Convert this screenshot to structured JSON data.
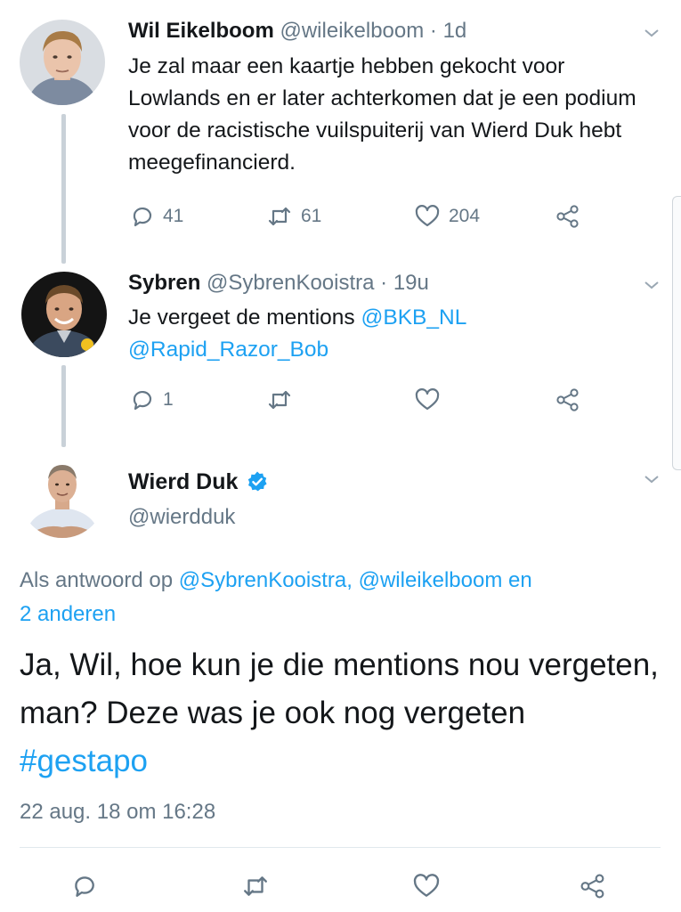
{
  "tweets": [
    {
      "display_name": "Wil Eikelboom",
      "handle": "@wileikelboom",
      "time": "· 1d",
      "text": "Je zal maar een kaartje hebben gekocht voor Lowlands en er later achterkomen dat je een podium voor de racistische vuilspuiterij van Wierd Duk hebt meegefinancierd.",
      "replies": "41",
      "retweets": "61",
      "likes": "204"
    },
    {
      "display_name": "Sybren",
      "handle": "@SybrenKooistra",
      "time": "· 19u",
      "text_prefix": "Je vergeet de mentions ",
      "mention_1": "@BKB_NL",
      "mention_2": "@Rapid_Razor_Bob",
      "replies": "1",
      "retweets": "",
      "likes": ""
    }
  ],
  "main_tweet": {
    "display_name": "Wierd Duk",
    "handle": "@wierdduk",
    "verified": true,
    "reply_prefix": "Als antwoord op ",
    "reply_to_1": "@SybrenKooistra,",
    "reply_to_2": "@wileikelboom",
    "reply_connector": " en",
    "reply_others": "2 anderen",
    "text": "Ja, Wil, hoe kun je die mentions nou vergeten, man? Deze was je ook nog vergeten ",
    "hashtag": "#gestapo",
    "timestamp": "22 aug. 18 om 16:28"
  },
  "colors": {
    "link": "#1da1f2",
    "muted": "#657786",
    "text": "#14171a",
    "thread_line": "#c9d1d8"
  },
  "icons": [
    "reply-icon",
    "retweet-icon",
    "like-icon",
    "share-icon",
    "chevron-down-icon",
    "verified-badge-icon"
  ]
}
